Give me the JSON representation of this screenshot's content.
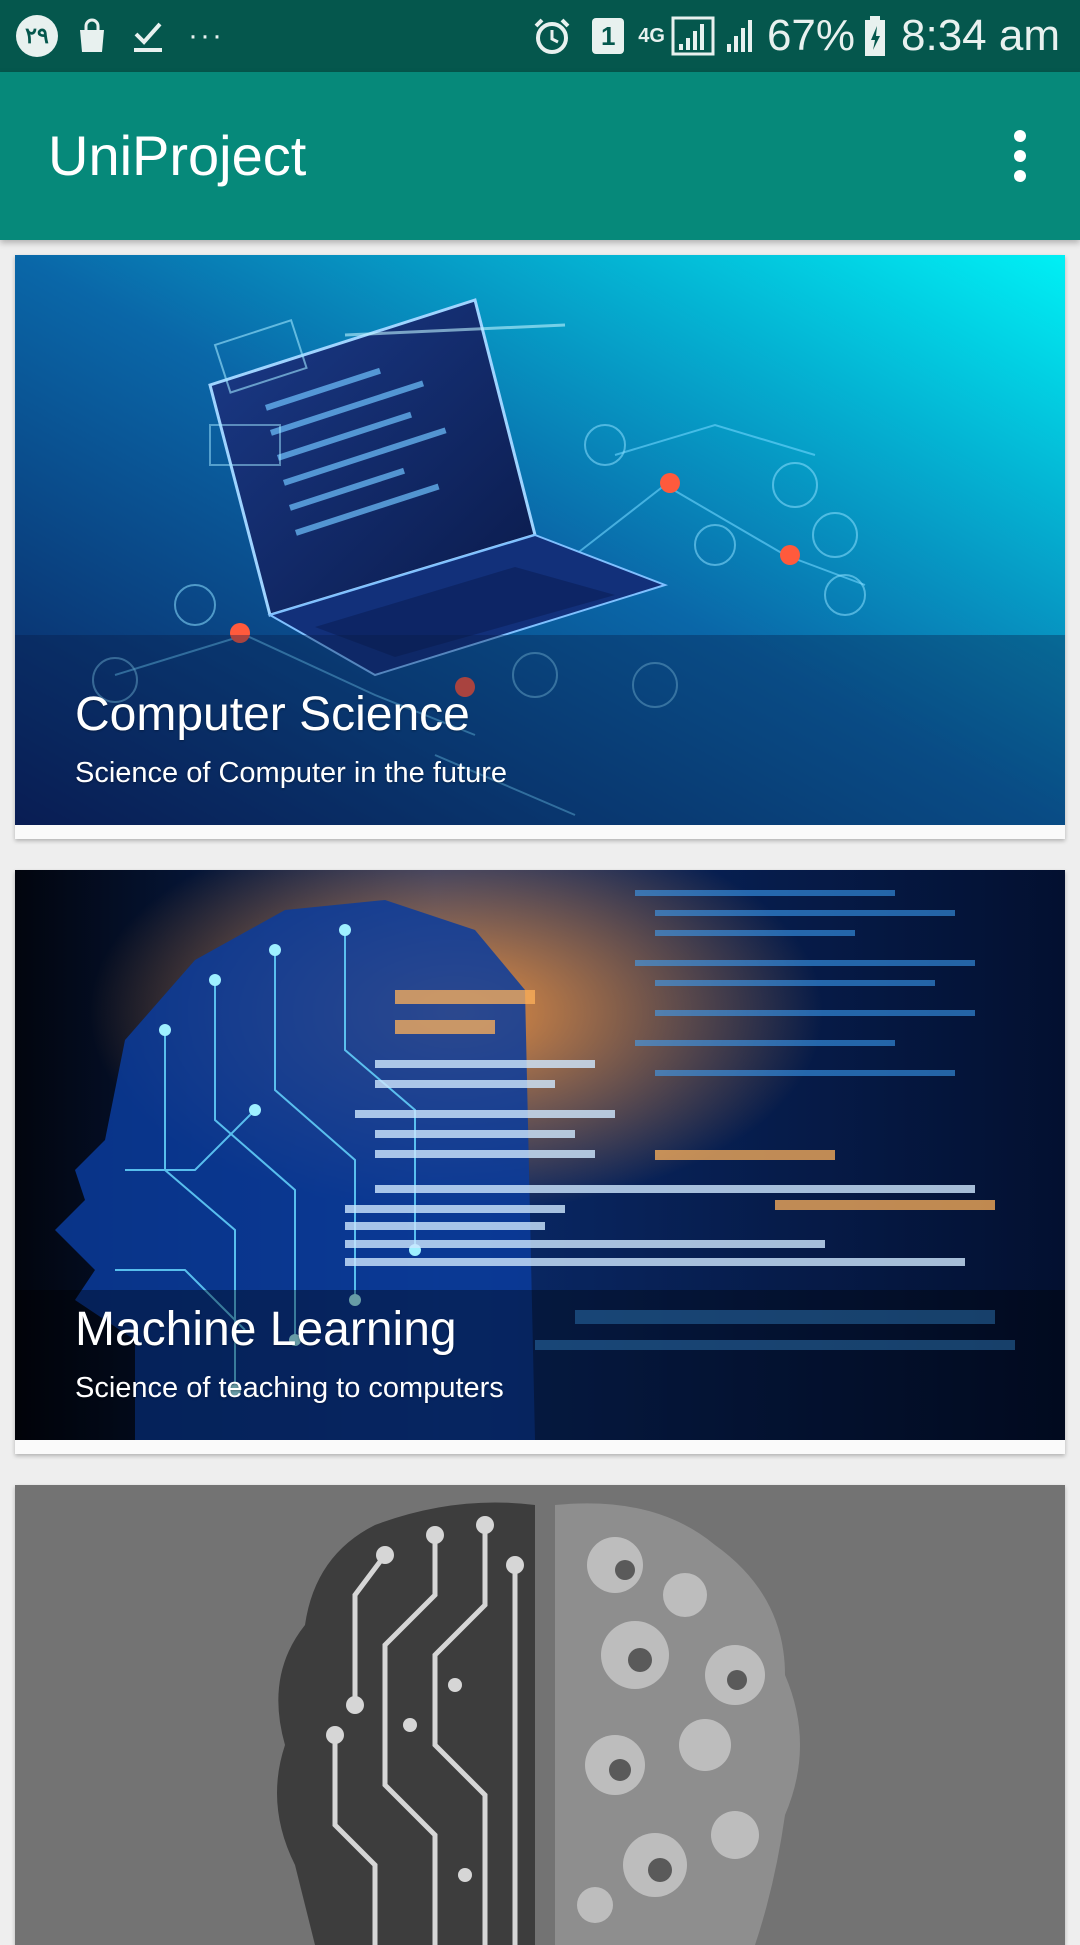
{
  "status_bar": {
    "notification_badge": "۲۹",
    "more_notifications": "···",
    "sim_slot": "1",
    "network_type": "4G",
    "battery_percent": "67%",
    "time": "8:34 am",
    "icons": [
      "circle-badge-icon",
      "shopping-bag-icon",
      "download-done-icon",
      "more-notifications-icon",
      "alarm-icon",
      "sim-slot-icon",
      "signal-icon",
      "battery-icon"
    ]
  },
  "app_bar": {
    "title": "UniProject",
    "overflow_icon": "more-vert-icon"
  },
  "cards": [
    {
      "title": "Computer Science",
      "subtitle": "Science of Computer in the future",
      "image": "laptop-circuit-image"
    },
    {
      "title": "Machine Learning",
      "subtitle": "Science of teaching to computers",
      "image": "ai-head-code-image"
    },
    {
      "title": "",
      "subtitle": "",
      "image": "circuit-brain-image"
    }
  ],
  "colors": {
    "status_bar": "#05574d",
    "app_bar": "#06897a",
    "background": "#eeeeee",
    "card": "#fafafa"
  }
}
